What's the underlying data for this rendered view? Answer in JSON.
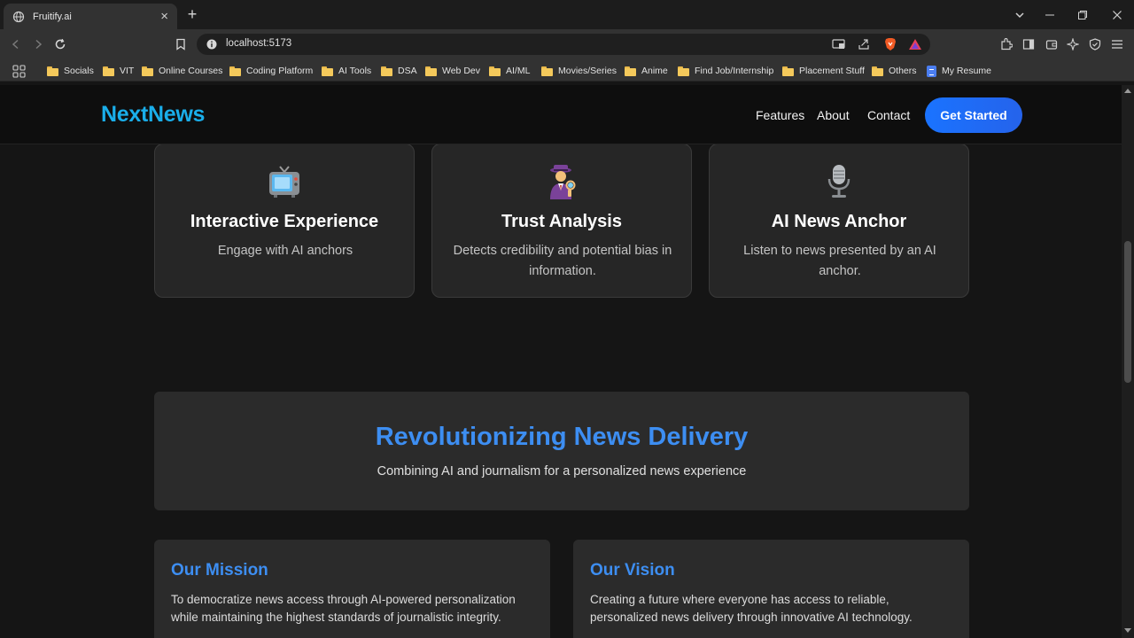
{
  "browser": {
    "tab_title": "Fruitify.ai",
    "url": "localhost:5173",
    "bookmarks": [
      "Socials",
      "VIT",
      "Online Courses",
      "Coding Platform",
      "AI Tools",
      "DSA",
      "Web Dev",
      "AI/ML",
      "Movies/Series",
      "Anime",
      "Find Job/Internship",
      "Placement Stuff",
      "Others",
      "My Resume"
    ]
  },
  "header": {
    "logo": "NextNews",
    "nav": [
      "Features",
      "About",
      "Contact"
    ],
    "cta": "Get Started"
  },
  "features": [
    {
      "icon": "television-icon",
      "title": "Interactive Experience",
      "desc": "Engage with AI anchors"
    },
    {
      "icon": "detective-icon",
      "title": "Trust Analysis",
      "desc": "Detects credibility and potential bias in information."
    },
    {
      "icon": "microphone-icon",
      "title": "AI News Anchor",
      "desc": "Listen to news presented by an AI anchor."
    }
  ],
  "banner": {
    "title": "Revolutionizing News Delivery",
    "subtitle": "Combining AI and journalism for a personalized news experience"
  },
  "mission": {
    "title": "Our Mission",
    "text": "To democratize news access through AI-powered personalization while maintaining the highest standards of journalistic integrity."
  },
  "vision": {
    "title": "Our Vision",
    "text": "Creating a future where everyone has access to reliable, personalized news delivery through innovative AI technology."
  },
  "colors": {
    "accent": "#3d8ef2",
    "logo": "#1aaeea",
    "cta": "#1a73ff",
    "background": "#151515"
  }
}
